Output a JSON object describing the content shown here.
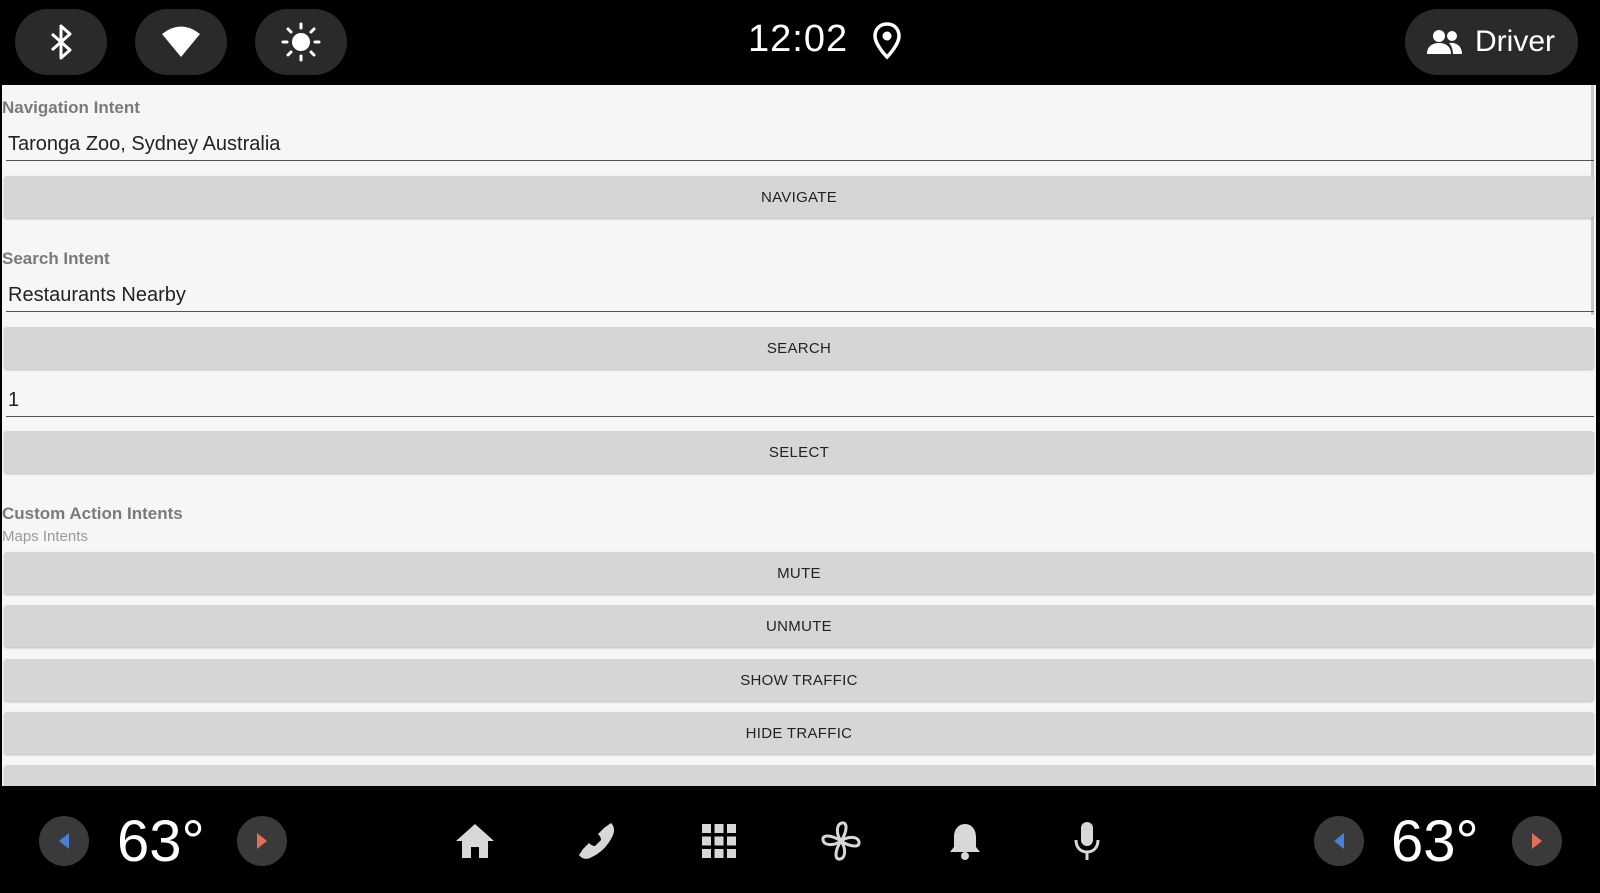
{
  "statusbar": {
    "clock": "12:02",
    "driver_label": "Driver",
    "icons": [
      "bluetooth-icon",
      "wifi-icon",
      "brightness-icon",
      "location-pin-icon",
      "people-icon"
    ]
  },
  "navigation": {
    "section_label": "Navigation Intent",
    "input_value": "Taronga Zoo, Sydney Australia",
    "button_label": "NAVIGATE"
  },
  "search": {
    "section_label": "Search Intent",
    "input_value": "Restaurants Nearby",
    "button_label": "SEARCH"
  },
  "select": {
    "input_value": "1",
    "button_label": "SELECT"
  },
  "custom": {
    "section_label": "Custom Action Intents",
    "sub_label": "Maps Intents",
    "buttons": [
      "MUTE",
      "UNMUTE",
      "SHOW TRAFFIC",
      "HIDE TRAFFIC"
    ]
  },
  "navbar": {
    "left_temp": "63°",
    "right_temp": "63°",
    "icons": [
      "home-icon",
      "phone-icon",
      "apps-grid-icon",
      "fan-icon",
      "bell-icon",
      "microphone-icon"
    ]
  },
  "colors": {
    "arrow_left": "#4a7fd6",
    "arrow_right": "#e0705a",
    "button_bg": "#d6d6d6",
    "panel_bg": "#f6f6f6"
  }
}
